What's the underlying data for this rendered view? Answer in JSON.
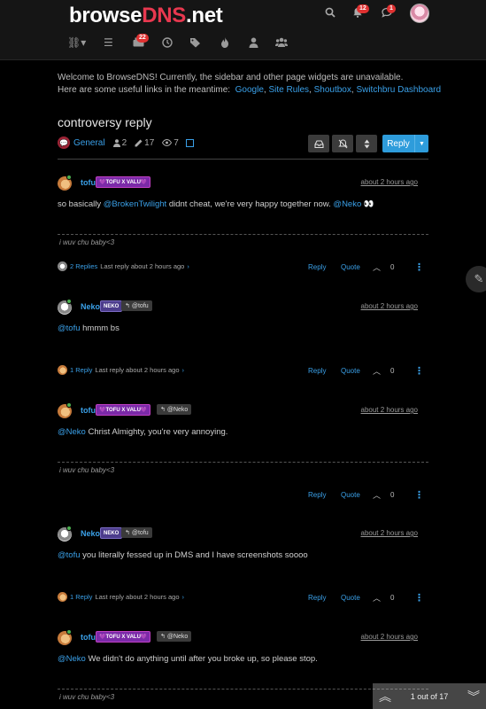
{
  "header": {
    "brand_prefix": "browse",
    "brand_accent": "DNS",
    "brand_suffix": ".net",
    "notifications_count": "12",
    "chats_count": "1",
    "unread_count": "22"
  },
  "welcome": {
    "line1": "Welcome to BrowseDNS! Currently, the sidebar and other page widgets are unavailable.",
    "line2_prefix": "Here are some useful links in the meantime:",
    "links": [
      "Google",
      "Site Rules",
      "Shoutbox",
      "Switchbru Dashboard"
    ]
  },
  "topic": {
    "title": "controversy reply",
    "category": "General",
    "posters": "2",
    "posts": "17",
    "views": "7",
    "reply_label": "Reply"
  },
  "posts": [
    {
      "user": "tofu",
      "group": "💜TOFU X VALU💜",
      "reply_to": "",
      "time": "about 2 hours ago",
      "mention1": "@BrokenTwilight",
      "mention2": "@Neko",
      "text_a": "so basically",
      "text_b": "didnt cheat, we're very happy together now.",
      "text_c": "👀",
      "signature": "i wuv chu baby<3",
      "replies": "2 Replies",
      "last_reply": "Last reply about 2 hours ago",
      "votes": "0"
    },
    {
      "user": "Neko",
      "group": "NEKO",
      "reply_to": "@tofu",
      "time": "about 2 hours ago",
      "mention": "@tofu",
      "text": "hmmm bs",
      "replies": "1 Reply",
      "last_reply": "Last reply about 2 hours ago",
      "votes": "0"
    },
    {
      "user": "tofu",
      "group": "💜TOFU X VALU💜",
      "reply_to": "@Neko",
      "time": "about 2 hours ago",
      "mention": "@Neko",
      "text": "Christ Almighty, you're very annoying.",
      "signature": "i wuv chu baby<3",
      "votes": "0"
    },
    {
      "user": "Neko",
      "group": "NEKO",
      "reply_to": "@tofu",
      "time": "about 2 hours ago",
      "mention": "@tofu",
      "text": "you literally fessed up in DMS and I have screenshots soooo",
      "replies": "1 Reply",
      "last_reply": "Last reply about 2 hours ago",
      "votes": "0"
    },
    {
      "user": "tofu",
      "group": "💜TOFU X VALU💜",
      "reply_to": "@Neko",
      "time": "about 2 hours ago",
      "mention": "@Neko",
      "text": "We didn't do anything until after you broke up, so please stop.",
      "signature": "i wuv chu baby<3"
    }
  ],
  "actions": {
    "reply": "Reply",
    "quote": "Quote"
  },
  "pager": {
    "text": "1 out of 17"
  },
  "colors": {
    "accent": "#3aa0e8",
    "brand_red": "#e8384f",
    "badge_red": "#e03131"
  }
}
